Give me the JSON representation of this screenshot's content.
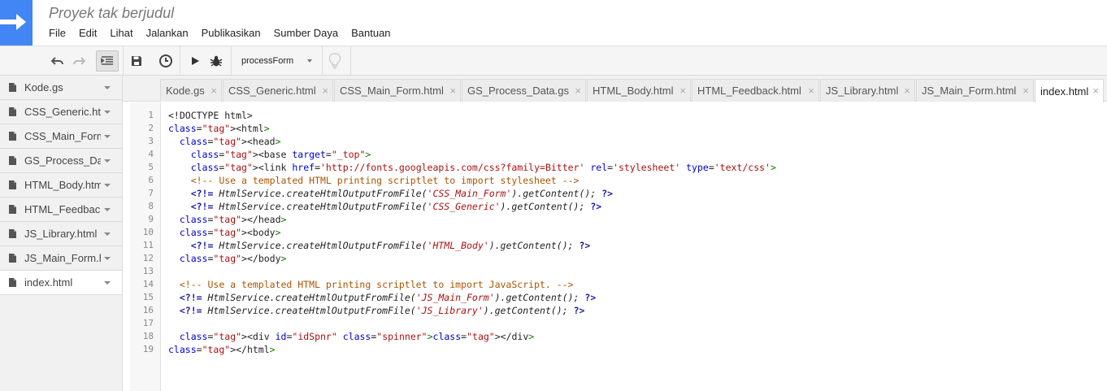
{
  "app": {
    "title": "Proyek tak berjudul"
  },
  "menu": [
    "File",
    "Edit",
    "Lihat",
    "Jalankan",
    "Publikasikan",
    "Sumber Daya",
    "Bantuan"
  ],
  "toolbar": {
    "function_select": "processForm"
  },
  "files": [
    {
      "name": "Kode.gs",
      "active": false
    },
    {
      "name": "CSS_Generic.html",
      "active": false
    },
    {
      "name": "CSS_Main_Form.html",
      "active": false
    },
    {
      "name": "GS_Process_Data.gs",
      "active": false
    },
    {
      "name": "HTML_Body.html",
      "active": false
    },
    {
      "name": "HTML_Feedback.html",
      "active": false
    },
    {
      "name": "JS_Library.html",
      "active": false
    },
    {
      "name": "JS_Main_Form.html",
      "active": false
    },
    {
      "name": "index.html",
      "active": true
    }
  ],
  "tabs": [
    {
      "name": "Kode.gs",
      "active": false
    },
    {
      "name": "CSS_Generic.html",
      "active": false
    },
    {
      "name": "CSS_Main_Form.html",
      "active": false
    },
    {
      "name": "GS_Process_Data.gs",
      "active": false
    },
    {
      "name": "HTML_Body.html",
      "active": false
    },
    {
      "name": "HTML_Feedback.html",
      "active": false
    },
    {
      "name": "JS_Library.html",
      "active": false
    },
    {
      "name": "JS_Main_Form.html",
      "active": false
    },
    {
      "name": "index.html",
      "active": true
    }
  ],
  "editor": {
    "lines": [
      "<!DOCTYPE html>",
      "<html>",
      "  <head>",
      "    <base target=\"_top\">",
      "    <link href='http://fonts.googleapis.com/css?family=Bitter' rel='stylesheet' type='text/css'>",
      "    <!-- Use a templated HTML printing scriptlet to import stylesheet -->",
      "    <?!= HtmlService.createHtmlOutputFromFile('CSS_Main_Form').getContent(); ?>",
      "    <?!= HtmlService.createHtmlOutputFromFile('CSS_Generic').getContent(); ?>",
      "  </head>",
      "  <body>",
      "    <?!= HtmlService.createHtmlOutputFromFile('HTML_Body').getContent(); ?>",
      "  </body>",
      "",
      "  <!-- Use a templated HTML printing scriptlet to import JavaScript. -->",
      "  <?!= HtmlService.createHtmlOutputFromFile('JS_Main_Form').getContent(); ?>",
      "  <?!= HtmlService.createHtmlOutputFromFile('JS_Library').getContent(); ?>",
      "",
      "  <div id=\"idSpnr\" class=\"spinner\"></div>",
      "</html>"
    ]
  },
  "colors": {
    "logo_blue": "#4285f4",
    "tag_green": "#117700",
    "attr_blue": "#0000cc",
    "string_red": "#aa1111",
    "comment_brown": "#aa5500"
  }
}
